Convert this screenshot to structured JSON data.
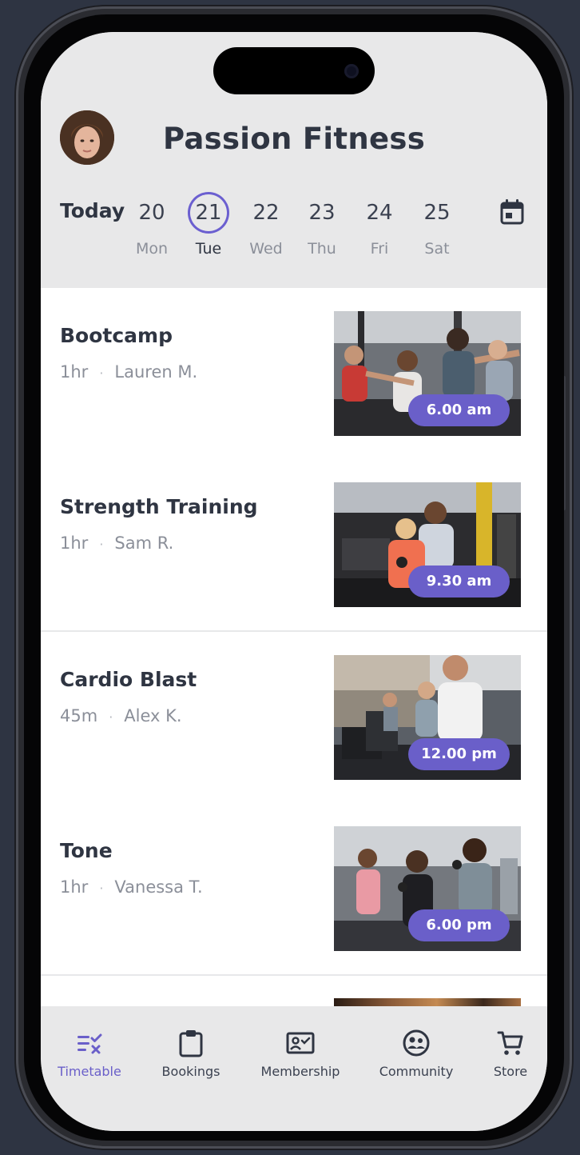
{
  "app": {
    "title": "Passion Fitness"
  },
  "user": {
    "avatar_alt": "User avatar"
  },
  "date_strip": {
    "today_label": "Today",
    "selected_index": 1,
    "days": [
      {
        "num": "20",
        "name": "Mon"
      },
      {
        "num": "21",
        "name": "Tue"
      },
      {
        "num": "22",
        "name": "Wed"
      },
      {
        "num": "23",
        "name": "Thu"
      },
      {
        "num": "24",
        "name": "Fri"
      },
      {
        "num": "25",
        "name": "Sat"
      }
    ],
    "calendar_icon": "calendar-icon"
  },
  "classes": [
    {
      "name": "Bootcamp",
      "duration": "1hr",
      "instructor": "Lauren M.",
      "time": "6.00 am",
      "separator": "·"
    },
    {
      "name": "Strength Training",
      "duration": "1hr",
      "instructor": "Sam R.",
      "time": "9.30 am",
      "separator": "·"
    },
    {
      "name": "Cardio Blast",
      "duration": "45m",
      "instructor": "Alex K.",
      "time": "12.00 pm",
      "separator": "·"
    },
    {
      "name": "Tone",
      "duration": "1hr",
      "instructor": "Vanessa T.",
      "time": "6.00 pm",
      "separator": "·"
    }
  ],
  "tabs": [
    {
      "label": "Timetable",
      "icon": "timetable-icon",
      "active": true
    },
    {
      "label": "Bookings",
      "icon": "clipboard-icon",
      "active": false
    },
    {
      "label": "Membership",
      "icon": "id-card-icon",
      "active": false
    },
    {
      "label": "Community",
      "icon": "community-icon",
      "active": false
    },
    {
      "label": "Store",
      "icon": "cart-icon",
      "active": false
    }
  ],
  "colors": {
    "accent": "#6a5fc9",
    "header_bg": "#e8e8e9",
    "text_dark": "#2f3542",
    "text_muted": "#8b8f99"
  }
}
